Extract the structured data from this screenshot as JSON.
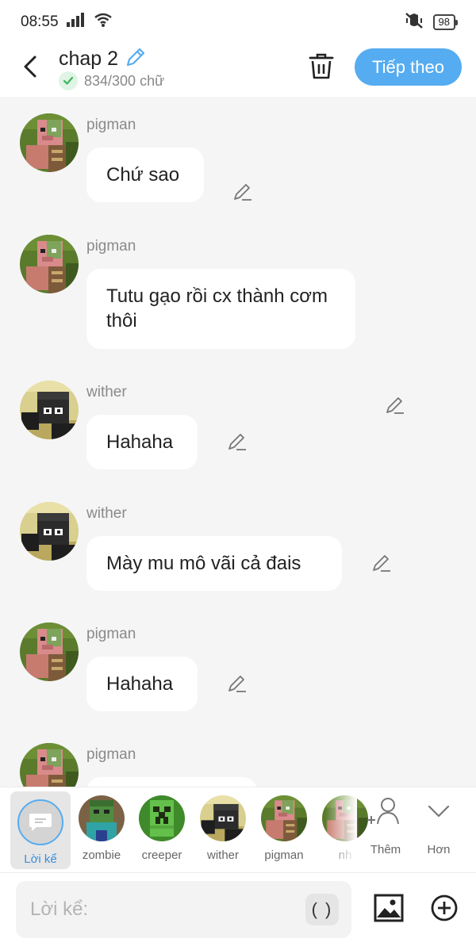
{
  "status_bar": {
    "time": "08:55",
    "battery": "98"
  },
  "header": {
    "title": "chap 2",
    "word_count": "834/300 chữ",
    "next_label": "Tiếp theo"
  },
  "messages": [
    {
      "sender": "pigman",
      "text": "Chứ sao"
    },
    {
      "sender": "pigman",
      "text": "Tutu gạo rồi cx thành cơm thôi"
    },
    {
      "sender": "wither",
      "text": "Hahaha"
    },
    {
      "sender": "wither",
      "text": "Mày mu mô vãi cả đais"
    },
    {
      "sender": "pigman",
      "text": "Hahaha"
    },
    {
      "sender": "pigman",
      "text": ""
    }
  ],
  "characters": [
    {
      "name": "Lời kể",
      "selected": true
    },
    {
      "name": "zombie"
    },
    {
      "name": "creeper"
    },
    {
      "name": "wither"
    },
    {
      "name": "pigman"
    },
    {
      "name": "nh"
    }
  ],
  "tools": {
    "add_label": "Thêm",
    "more_label": "Hơn"
  },
  "composer": {
    "placeholder": "Lời kể:",
    "paren_label": "( )"
  },
  "colors": {
    "accent": "#55acf0",
    "check": "#3cb35c",
    "background": "#f5f5f5"
  }
}
